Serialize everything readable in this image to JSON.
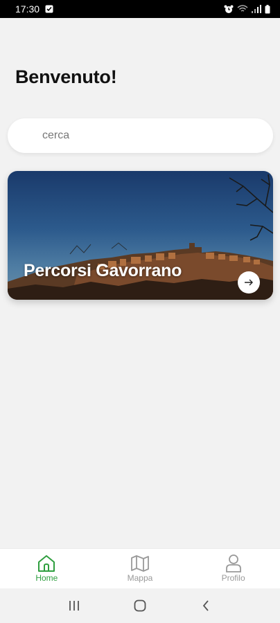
{
  "status_bar": {
    "time": "17:30"
  },
  "header": {
    "welcome": "Benvenuto!"
  },
  "search": {
    "placeholder": "cerca"
  },
  "card": {
    "title": "Percorsi Gavorrano"
  },
  "bottom_nav": {
    "items": [
      {
        "label": "Home",
        "icon": "home-icon",
        "active": true
      },
      {
        "label": "Mappa",
        "icon": "map-icon",
        "active": false
      },
      {
        "label": "Profilo",
        "icon": "user-icon",
        "active": false
      }
    ]
  },
  "colors": {
    "accent": "#2e9e3e",
    "background": "#f2f2f2",
    "inactive": "#999999"
  }
}
